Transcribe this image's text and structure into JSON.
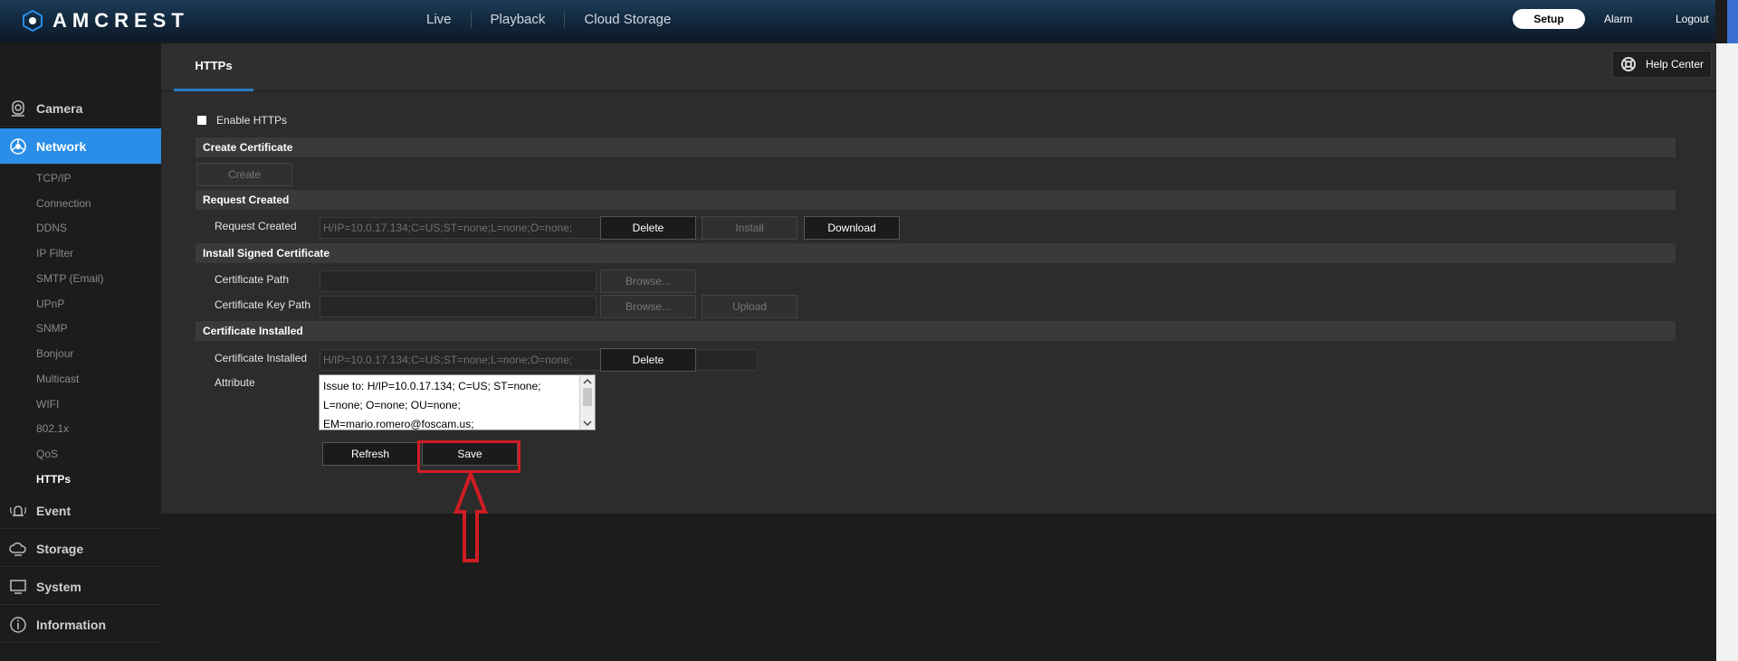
{
  "header": {
    "logo_text": "AMCREST",
    "nav": [
      "Live",
      "Playback",
      "Cloud Storage"
    ],
    "setup": "Setup",
    "alarm": "Alarm",
    "logout": "Logout"
  },
  "sidebar": {
    "sections": {
      "camera": "Camera",
      "network": "Network",
      "event": "Event",
      "storage": "Storage",
      "system": "System",
      "information": "Information"
    },
    "network_items": [
      "TCP/IP",
      "Connection",
      "DDNS",
      "IP Filter",
      "SMTP (Email)",
      "UPnP",
      "SNMP",
      "Bonjour",
      "Multicast",
      "WIFI",
      "802.1x",
      "QoS",
      "HTTPs"
    ]
  },
  "main": {
    "tab": "HTTPs",
    "help": "Help Center",
    "enable_label": "Enable HTTPs",
    "create_section": "Create Certificate",
    "create_button": "Create",
    "request_section": "Request Created",
    "request_label": "Request Created",
    "request_value": "H/IP=10.0.17.134;C=US;ST=none;L=none;O=none;",
    "delete": "Delete",
    "install": "Install",
    "download": "Download",
    "install_section": "Install Signed Certificate",
    "cert_path_label": "Certificate Path",
    "cert_key_label": "Certificate Key Path",
    "browse": "Browse...",
    "upload": "Upload",
    "installed_section": "Certificate Installed",
    "installed_label": "Certificate Installed",
    "installed_value": "H/IP=10.0.17.134;C=US;ST=none;L=none;O=none;",
    "attribute_label": "Attribute",
    "attribute_lines": [
      "Issue to: H/IP=10.0.17.134; C=US; ST=none;",
      "L=none; O=none; OU=none;",
      "EM=mario.romero@foscam.us;"
    ],
    "refresh": "Refresh",
    "save": "Save"
  },
  "colors": {
    "accent": "#2a8ee8",
    "highlight": "#d01c24"
  }
}
